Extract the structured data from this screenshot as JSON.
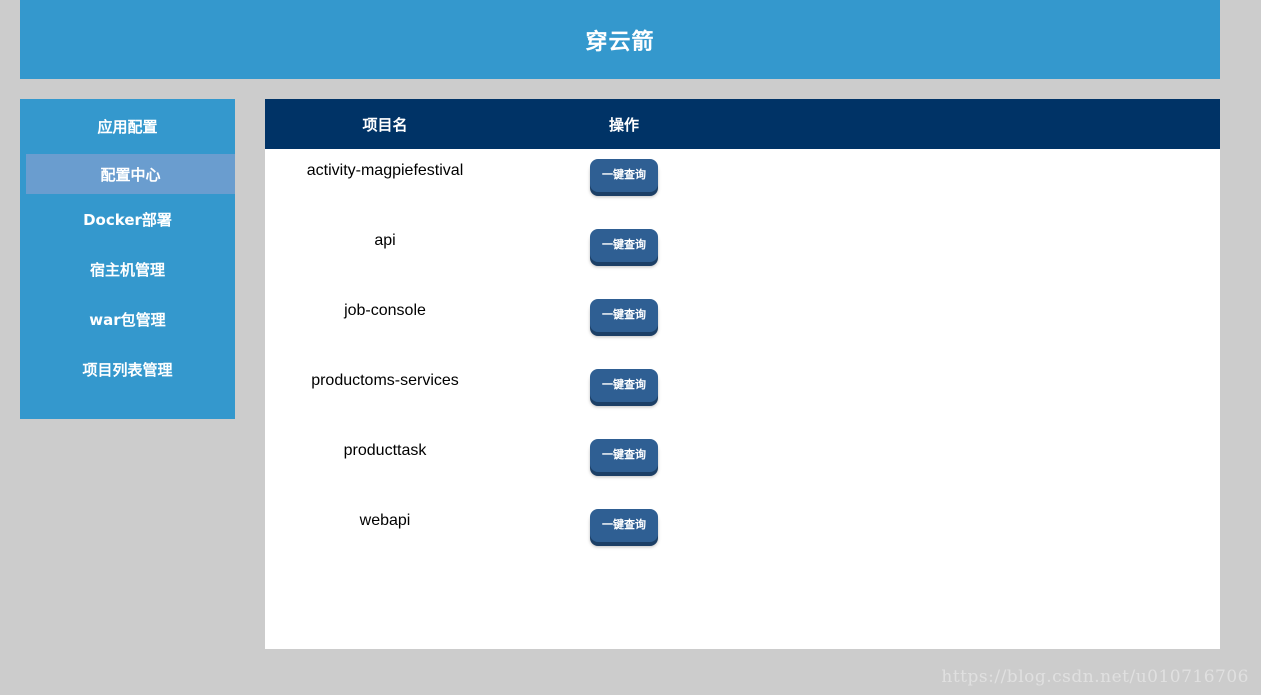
{
  "header": {
    "title": "穿云箭"
  },
  "sidebar": {
    "items": [
      {
        "label": "应用配置"
      },
      {
        "label": "配置中心"
      },
      {
        "label": "Docker部署"
      },
      {
        "label": "宿主机管理"
      },
      {
        "label": "war包管理"
      },
      {
        "label": "项目列表管理"
      }
    ]
  },
  "table": {
    "headers": {
      "name": "项目名",
      "op": "操作"
    },
    "rows": [
      {
        "name": "activity-magpiefestival",
        "action": "一键查询"
      },
      {
        "name": "api",
        "action": "一键查询"
      },
      {
        "name": "job-console",
        "action": "一键查询"
      },
      {
        "name": "productoms-services",
        "action": "一键查询"
      },
      {
        "name": "producttask",
        "action": "一键查询"
      },
      {
        "name": "webapi",
        "action": "一键查询"
      }
    ]
  },
  "watermark": "https://blog.csdn.net/u010716706",
  "colors": {
    "background": "#cccccc",
    "header": "#3498cd",
    "sidebar_active_sub": "#6a9dcf",
    "table_header": "#003366",
    "button": "#2f5f93"
  }
}
